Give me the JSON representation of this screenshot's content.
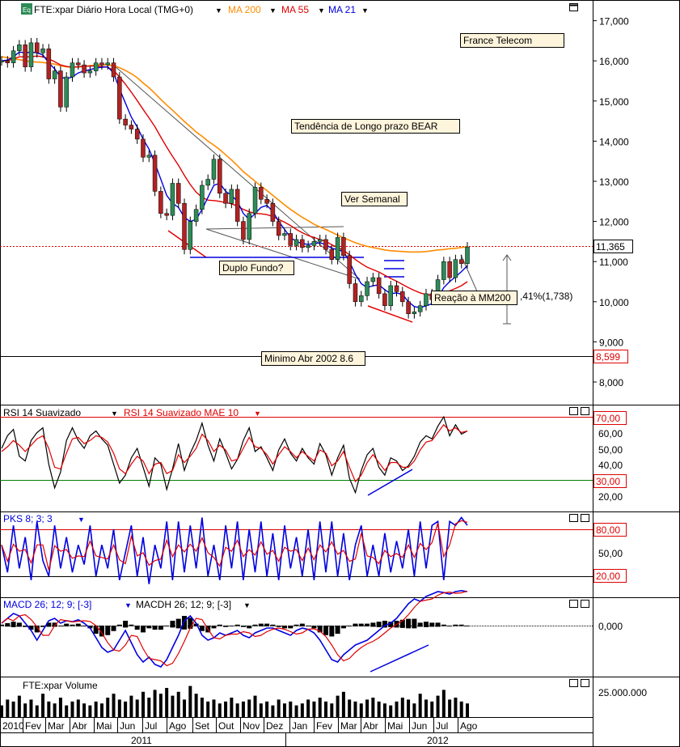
{
  "window": {
    "symbol_badge": "Eq",
    "title": "FTE:xpar Diário Hora Local (TMG+0)",
    "ma_labels": [
      {
        "text": "MA 200",
        "color": "#ff8c00"
      },
      {
        "text": "MA 55",
        "color": "#e00000"
      },
      {
        "text": "MA 21",
        "color": "#0000e0"
      }
    ]
  },
  "chart_data": [
    {
      "type": "line",
      "title": "FTE:xpar",
      "yticks": [
        "17,000",
        "16,000",
        "15,000",
        "14,000",
        "13,000",
        "12,000",
        "11,000",
        "10,000",
        "9,000",
        "8,000"
      ],
      "ylim": [
        7.5,
        17.7
      ],
      "last_price": "11,365",
      "min_label": "8,599",
      "annotations": [
        "France Telecom",
        "Tendência de Longo prazo BEAR",
        "Ver Semanal",
        "Duplo Fundo?",
        "Reação à MM200",
        "Minimo Abr 2002 8.6",
        ",41%(1,738)"
      ],
      "series": [
        {
          "name": "Close",
          "values": [
            16.0,
            15.95,
            16.25,
            16.4,
            15.85,
            16.45,
            16.2,
            16.3,
            15.55,
            15.75,
            14.85,
            15.6,
            15.95,
            15.9,
            15.7,
            15.75,
            15.95,
            15.9,
            15.95,
            15.6,
            14.55,
            14.4,
            14.3,
            14.05,
            13.6,
            13.65,
            12.75,
            12.2,
            12.15,
            12.95,
            12.45,
            11.3,
            12.0,
            12.3,
            12.9,
            13.05,
            13.55,
            12.7,
            12.45,
            12.8,
            12.0,
            11.55,
            12.2,
            12.85,
            12.55,
            12.45,
            12.0,
            11.65,
            11.7,
            11.4,
            11.55,
            11.35,
            11.4,
            11.5,
            11.55,
            11.3,
            11.05,
            11.6,
            11.15,
            10.45,
            10.0,
            10.15,
            10.5,
            10.6,
            10.2,
            9.9,
            10.4,
            10.25,
            10.0,
            9.7,
            9.75,
            9.9,
            10.2,
            10.05,
            10.55,
            11.0,
            10.6,
            11.05,
            10.95,
            11.365
          ]
        },
        {
          "name": "MA 200",
          "values": [
            16.1,
            16.08,
            16.05,
            16.03,
            16.0,
            15.98,
            15.97,
            15.96,
            15.94,
            15.92,
            15.88,
            15.85,
            15.84,
            15.85,
            15.86,
            15.88,
            15.9,
            15.91,
            15.9,
            15.88,
            15.83,
            15.76,
            15.68,
            15.58,
            15.45,
            15.33,
            15.19,
            15.04,
            14.9,
            14.77,
            14.63,
            14.49,
            14.36,
            14.23,
            14.12,
            14.0,
            13.9,
            13.79,
            13.66,
            13.53,
            13.39,
            13.24,
            13.12,
            13.0,
            12.88,
            12.77,
            12.65,
            12.53,
            12.41,
            12.3,
            12.2,
            12.1,
            12.02,
            11.93,
            11.86,
            11.8,
            11.73,
            11.66,
            11.59,
            11.53,
            11.47,
            11.42,
            11.38,
            11.35,
            11.32,
            11.29,
            11.27,
            11.26,
            11.25,
            11.24,
            11.24,
            11.24,
            11.25,
            11.27,
            11.29,
            11.3,
            11.32,
            11.33,
            11.35,
            11.37
          ]
        },
        {
          "name": "MA 55",
          "values": [
            16.0,
            16.0,
            16.05,
            16.1,
            16.1,
            16.1,
            16.12,
            16.1,
            16.05,
            15.98,
            15.9,
            15.86,
            15.84,
            15.85,
            15.86,
            15.87,
            15.87,
            15.86,
            15.84,
            15.76,
            15.6,
            15.42,
            15.22,
            15.01,
            14.79,
            14.58,
            14.36,
            14.1,
            13.85,
            13.62,
            13.4,
            13.15,
            12.92,
            12.73,
            12.6,
            12.53,
            12.52,
            12.5,
            12.47,
            12.44,
            12.38,
            12.3,
            12.24,
            12.2,
            12.19,
            12.17,
            12.12,
            12.05,
            11.98,
            11.9,
            11.8,
            11.72,
            11.65,
            11.6,
            11.55,
            11.5,
            11.42,
            11.35,
            11.28,
            11.17,
            11.05,
            10.95,
            10.86,
            10.8,
            10.74,
            10.66,
            10.58,
            10.51,
            10.43,
            10.35,
            10.28,
            10.22,
            10.18,
            10.16,
            10.18,
            10.22,
            10.27,
            10.33,
            10.4,
            10.5
          ]
        },
        {
          "name": "MA 21",
          "values": [
            16.0,
            16.02,
            16.1,
            16.22,
            16.2,
            16.22,
            16.2,
            16.15,
            15.95,
            15.8,
            15.6,
            15.55,
            15.6,
            15.7,
            15.75,
            15.78,
            15.82,
            15.84,
            15.85,
            15.7,
            15.3,
            14.95,
            14.6,
            14.35,
            14.05,
            13.8,
            13.45,
            13.05,
            12.65,
            12.45,
            12.35,
            12.1,
            12.0,
            12.05,
            12.3,
            12.6,
            12.9,
            12.95,
            12.75,
            12.65,
            12.5,
            12.2,
            12.05,
            12.2,
            12.35,
            12.4,
            12.25,
            12.0,
            11.8,
            11.6,
            11.5,
            11.45,
            11.43,
            11.45,
            11.47,
            11.42,
            11.33,
            11.3,
            11.25,
            11.0,
            10.68,
            10.45,
            10.35,
            10.4,
            10.42,
            10.3,
            10.2,
            10.22,
            10.18,
            10.0,
            9.88,
            9.85,
            9.9,
            9.95,
            10.1,
            10.35,
            10.5,
            10.62,
            10.75,
            10.9
          ]
        }
      ]
    },
    {
      "type": "line",
      "title": "RSI 14 Suavizado",
      "legend": [
        "RSI 14 Suavizado",
        "RSI 14 Suavizado MAE 10"
      ],
      "yticks": [
        "60,00",
        "50,00",
        "40,00",
        "20,00"
      ],
      "levels": [
        "70,00",
        "30,00"
      ],
      "ylim": [
        10,
        75
      ],
      "series": [
        {
          "name": "RSI 14 Suavizado",
          "values": [
            50,
            58,
            62,
            45,
            42,
            55,
            60,
            63,
            40,
            25,
            35,
            55,
            63,
            55,
            50,
            58,
            61,
            56,
            52,
            40,
            28,
            33,
            44,
            50,
            38,
            26,
            44,
            40,
            24,
            37,
            53,
            36,
            47,
            55,
            66,
            52,
            42,
            56,
            47,
            37,
            43,
            55,
            63,
            48,
            51,
            44,
            36,
            49,
            56,
            47,
            42,
            50,
            44,
            40,
            53,
            46,
            33,
            44,
            52,
            31,
            22,
            36,
            46,
            50,
            38,
            33,
            44,
            42,
            36,
            39,
            45,
            54,
            58,
            56,
            64,
            70,
            58,
            65,
            59,
            61
          ]
        },
        {
          "name": "RSI 14 Suavizado MAE 10",
          "values": [
            48,
            51,
            55,
            52,
            48,
            52,
            56,
            58,
            50,
            38,
            37,
            47,
            56,
            57,
            53,
            55,
            58,
            57,
            54,
            47,
            37,
            34,
            40,
            45,
            42,
            34,
            40,
            41,
            34,
            36,
            46,
            41,
            45,
            50,
            59,
            55,
            48,
            52,
            49,
            42,
            43,
            50,
            57,
            51,
            50,
            46,
            40,
            46,
            51,
            48,
            44,
            48,
            45,
            42,
            49,
            47,
            39,
            42,
            48,
            38,
            29,
            33,
            41,
            46,
            41,
            36,
            41,
            41,
            38,
            38,
            42,
            49,
            54,
            55,
            60,
            65,
            61,
            63,
            60,
            61
          ]
        }
      ]
    },
    {
      "type": "line",
      "title": "PKS 8; 3; 3",
      "yticks": [
        "50,00"
      ],
      "levels": [
        "80,00",
        "20,00"
      ],
      "ylim": [
        0,
        105
      ],
      "series": [
        {
          "name": "PKS 8; 3; 3",
          "values": [
            60,
            25,
            85,
            30,
            70,
            15,
            90,
            40,
            20,
            85,
            30,
            70,
            25,
            60,
            35,
            85,
            20,
            60,
            30,
            80,
            15,
            50,
            85,
            20,
            70,
            10,
            60,
            30,
            90,
            15,
            90,
            25,
            85,
            30,
            95,
            20,
            60,
            15,
            85,
            30,
            90,
            15,
            80,
            25,
            90,
            20,
            75,
            15,
            85,
            30,
            70,
            20,
            80,
            15,
            90,
            25,
            90,
            20,
            75,
            15,
            60,
            85,
            20,
            60,
            20,
            75,
            25,
            65,
            30,
            80,
            20,
            90,
            30,
            85,
            90,
            15,
            90,
            85,
            95,
            85
          ]
        }
      ]
    },
    {
      "type": "line",
      "title": "MACD 26; 12; 9; [-3]",
      "legend": [
        "MACD 26; 12; 9; [-3]",
        "MACDH 26; 12; 9; [-3]"
      ],
      "yticks": [
        "0,000"
      ],
      "series": [
        {
          "name": "MACD 26; 12; 9; [-3]",
          "values": [
            0.05,
            0.15,
            0.25,
            0.2,
            0.05,
            -0.1,
            -0.3,
            -0.1,
            0.1,
            0.15,
            0.05,
            0.1,
            0.08,
            0.12,
            0.05,
            -0.05,
            -0.25,
            -0.45,
            -0.55,
            -0.5,
            -0.3,
            -0.1,
            -0.35,
            -0.6,
            -0.75,
            -0.65,
            -0.8,
            -0.85,
            -0.7,
            -0.45,
            -0.2,
            0.1,
            0.2,
            0.05,
            -0.2,
            -0.3,
            -0.25,
            -0.15,
            -0.2,
            -0.15,
            -0.1,
            -0.2,
            -0.25,
            -0.15,
            -0.1,
            -0.05,
            -0.05,
            -0.1,
            -0.15,
            -0.2,
            -0.1,
            -0.05,
            -0.08,
            -0.15,
            -0.3,
            -0.5,
            -0.7,
            -0.75,
            -0.6,
            -0.5,
            -0.4,
            -0.35,
            -0.3,
            -0.2,
            -0.1,
            0.0,
            0.05,
            0.15,
            0.3,
            0.45,
            0.55,
            0.5,
            0.6,
            0.65,
            0.7,
            0.68,
            0.65,
            0.7,
            0.72,
            0.7
          ]
        },
        {
          "name": "MACDH 26; 12; 9; [-3]",
          "values": [
            0.02,
            0.05,
            0.08,
            0.06,
            -0.02,
            -0.06,
            -0.1,
            -0.02,
            0.06,
            0.06,
            0.0,
            0.04,
            0.02,
            0.04,
            0.0,
            -0.04,
            -0.12,
            -0.16,
            -0.14,
            -0.08,
            0.02,
            0.1,
            0.02,
            -0.06,
            -0.1,
            -0.04,
            -0.06,
            -0.06,
            0.0,
            0.1,
            0.14,
            0.2,
            0.16,
            0.04,
            -0.08,
            -0.1,
            -0.04,
            0.02,
            -0.02,
            0.0,
            0.02,
            -0.02,
            -0.04,
            0.02,
            0.04,
            0.04,
            0.02,
            -0.02,
            -0.04,
            -0.04,
            0.02,
            0.04,
            0.0,
            -0.04,
            -0.1,
            -0.14,
            -0.16,
            -0.12,
            -0.04,
            0.0,
            0.04,
            0.04,
            0.04,
            0.06,
            0.08,
            0.1,
            0.08,
            0.1,
            0.12,
            0.14,
            0.14,
            0.06,
            0.08,
            0.06,
            0.06,
            0.02,
            0.0,
            0.02,
            0.02,
            0.0
          ]
        }
      ]
    },
    {
      "type": "bar",
      "title": "FTE:xpar Volume",
      "yticks": [
        "25.000.000"
      ],
      "values": [
        6,
        9,
        8,
        11,
        7,
        9,
        6,
        12,
        8,
        7,
        10,
        6,
        8,
        9,
        7,
        6,
        8,
        7,
        10,
        12,
        9,
        8,
        11,
        9,
        13,
        10,
        14,
        12,
        15,
        11,
        13,
        9,
        16,
        12,
        10,
        8,
        9,
        7,
        8,
        10,
        7,
        8,
        9,
        11,
        7,
        8,
        6,
        9,
        7,
        8,
        6,
        7,
        9,
        8,
        10,
        8,
        7,
        11,
        13,
        9,
        8,
        7,
        9,
        10,
        8,
        7,
        6,
        8,
        10,
        9,
        7,
        12,
        9,
        8,
        11,
        14,
        9,
        10,
        8,
        7
      ]
    }
  ],
  "xaxis": {
    "months": [
      "2010",
      "Fev",
      "Mar",
      "Abr",
      "Mai",
      "Jun",
      "Jul",
      "Ago",
      "Set",
      "Out",
      "Nov",
      "Dez",
      "Jan",
      "Fev",
      "Mar",
      "Abr",
      "Mai",
      "Jun",
      "Jul",
      "Ago"
    ],
    "years": [
      "2011",
      "2012"
    ]
  }
}
